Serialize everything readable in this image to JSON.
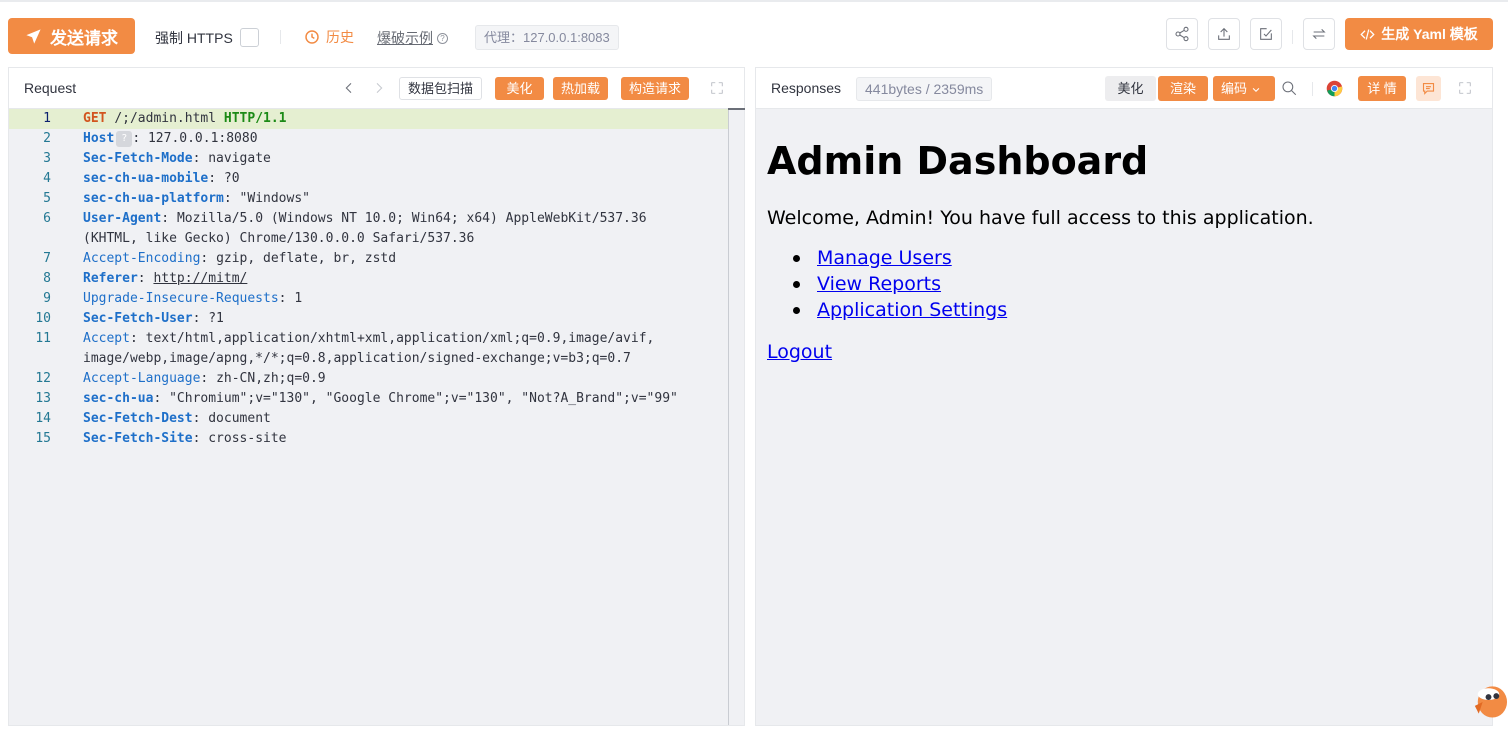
{
  "toolbar": {
    "send_label": "发送请求",
    "https_label": "强制 HTTPS",
    "history_label": "历史",
    "example_label": "爆破示例",
    "proxy_label": "代理：127.0.0.1:8083",
    "yaml_label": "生成 Yaml 模板",
    "icons": [
      "share-icon",
      "export-icon",
      "import-icon",
      "swap-icon"
    ]
  },
  "request": {
    "title": "Request",
    "scan_label": "数据包扫描",
    "beautify_label": "美化",
    "hotload_label": "热加载",
    "construct_label": "构造请求",
    "lines": [
      {
        "n": "1",
        "method": "GET",
        "path": "/;/admin.html",
        "proto": "HTTP/1.1"
      },
      {
        "n": "2",
        "key": "Host",
        "hint": "?",
        "value": "127.0.0.1:8080"
      },
      {
        "n": "3",
        "key": "Sec-Fetch-Mode",
        "value": "navigate"
      },
      {
        "n": "4",
        "key": "sec-ch-ua-mobile",
        "value": "?0"
      },
      {
        "n": "5",
        "key": "sec-ch-ua-platform",
        "value": "\"Windows\""
      },
      {
        "n": "6",
        "key": "User-Agent",
        "value": "Mozilla/5.0 (Windows NT 10.0; Win64; x64) AppleWebKit/537.36",
        "cont": "(KHTML, like Gecko) Chrome/130.0.0.0 Safari/537.36"
      },
      {
        "n": "7",
        "key": "Accept-Encoding",
        "value": "gzip, deflate, br, zstd"
      },
      {
        "n": "8",
        "key": "Referer",
        "value": "http://mitm/"
      },
      {
        "n": "9",
        "key": "Upgrade-Insecure-Requests",
        "value": "1"
      },
      {
        "n": "10",
        "key": "Sec-Fetch-User",
        "value": "?1"
      },
      {
        "n": "11",
        "key": "Accept",
        "value": "text/html,application/xhtml+xml,application/xml;q=0.9,image/avif,",
        "cont": "image/webp,image/apng,*/*;q=0.8,application/signed-exchange;v=b3;q=0.7"
      },
      {
        "n": "12",
        "key": "Accept-Language",
        "value": "zh-CN,zh;q=0.9"
      },
      {
        "n": "13",
        "key": "sec-ch-ua",
        "value": "\"Chromium\";v=\"130\", \"Google Chrome\";v=\"130\", \"Not?A_Brand\";v=\"99\""
      },
      {
        "n": "14",
        "key": "Sec-Fetch-Dest",
        "value": "document"
      },
      {
        "n": "15",
        "key": "Sec-Fetch-Site",
        "value": "cross-site"
      }
    ]
  },
  "response": {
    "title": "Responses",
    "size_label": "441bytes / 2359ms",
    "beautify_label": "美化",
    "render_label": "渲染",
    "encode_label": "编码",
    "detail_label": "详 情",
    "page": {
      "heading": "Admin Dashboard",
      "welcome": "Welcome, Admin! You have full access to this application.",
      "links": [
        "Manage Users",
        "View Reports",
        "Application Settings"
      ],
      "logout": "Logout"
    }
  }
}
